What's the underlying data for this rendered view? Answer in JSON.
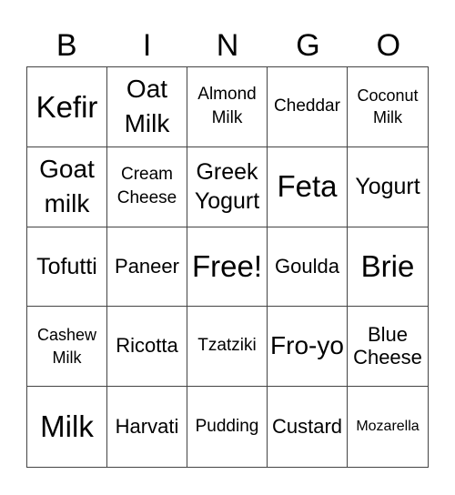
{
  "header": [
    "B",
    "I",
    "N",
    "G",
    "O"
  ],
  "cells": [
    {
      "label": "Kefir",
      "size": "s1"
    },
    {
      "label": "Oat Milk",
      "size": "s2"
    },
    {
      "label": "Almond Milk",
      "size": "s5"
    },
    {
      "label": "Cheddar",
      "size": "s5"
    },
    {
      "label": "Coconut Milk",
      "size": "s6"
    },
    {
      "label": "Goat milk",
      "size": "s2"
    },
    {
      "label": "Cream Cheese",
      "size": "s5"
    },
    {
      "label": "Greek Yogurt",
      "size": "s3"
    },
    {
      "label": "Feta",
      "size": "s1"
    },
    {
      "label": "Yogurt",
      "size": "s3"
    },
    {
      "label": "Tofutti",
      "size": "s3"
    },
    {
      "label": "Paneer",
      "size": "s4"
    },
    {
      "label": "Free!",
      "size": "s1",
      "free": true
    },
    {
      "label": "Goulda",
      "size": "s4"
    },
    {
      "label": "Brie",
      "size": "s1"
    },
    {
      "label": "Cashew Milk",
      "size": "s6"
    },
    {
      "label": "Ricotta",
      "size": "s4"
    },
    {
      "label": "Tzatziki",
      "size": "s5"
    },
    {
      "label": "Fro-yo",
      "size": "s2"
    },
    {
      "label": "Blue Cheese",
      "size": "s4"
    },
    {
      "label": "Milk",
      "size": "s1"
    },
    {
      "label": "Harvati",
      "size": "s4"
    },
    {
      "label": "Pudding",
      "size": "s5"
    },
    {
      "label": "Custard",
      "size": "s4"
    },
    {
      "label": "Mozarella",
      "size": "s7"
    }
  ]
}
